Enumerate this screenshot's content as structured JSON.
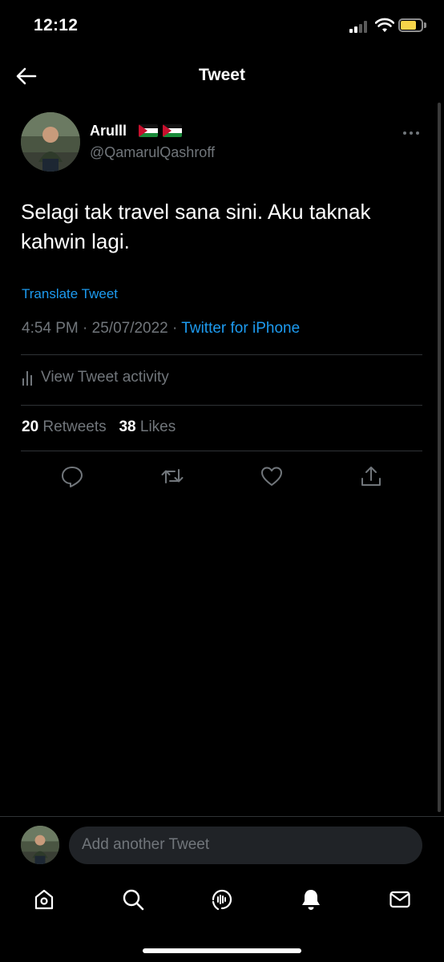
{
  "status_bar": {
    "time": "12:12",
    "battery_level": 0.75
  },
  "header": {
    "title": "Tweet",
    "back_icon": "arrow-left-icon"
  },
  "tweet": {
    "author": {
      "display_name": "Arulll",
      "handle": "@QamarulQashroff",
      "flags": [
        "palestine-flag",
        "palestine-flag"
      ]
    },
    "text": "Selagi tak travel sana sini. Aku taknak kahwin lagi.",
    "translate_label": "Translate Tweet",
    "time": "4:54 PM",
    "date": "25/07/2022",
    "separator": " · ",
    "source": "Twitter for iPhone",
    "activity_label": "View Tweet activity",
    "retweets_count": "20",
    "retweets_label": "Retweets",
    "likes_count": "38",
    "likes_label": "Likes"
  },
  "actions": [
    "reply-icon",
    "retweet-icon",
    "like-icon",
    "share-icon"
  ],
  "reply": {
    "placeholder": "Add another Tweet"
  },
  "bottom_nav": [
    "home-icon",
    "search-icon",
    "spaces-icon",
    "notifications-icon",
    "messages-icon"
  ],
  "colors": {
    "background": "#000000",
    "accent": "#1d9bf0",
    "muted": "#71767b",
    "divider": "#2f3336"
  }
}
